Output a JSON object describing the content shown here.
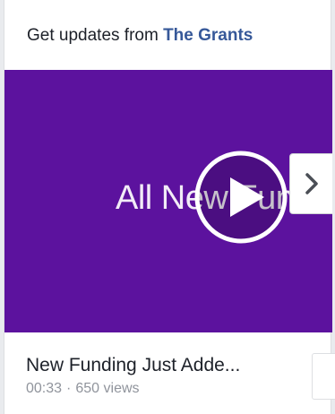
{
  "header": {
    "prefix": "Get updates from",
    "page_name": "The Grants"
  },
  "video": {
    "overlay_text": "All New Fundi",
    "background_color": "#5c129e",
    "play_icon": "play-icon",
    "next_icon": "chevron-right-icon"
  },
  "footer": {
    "title": "New Funding Just Adde...",
    "duration": "00:33",
    "separator": "·",
    "views": "650 views"
  }
}
